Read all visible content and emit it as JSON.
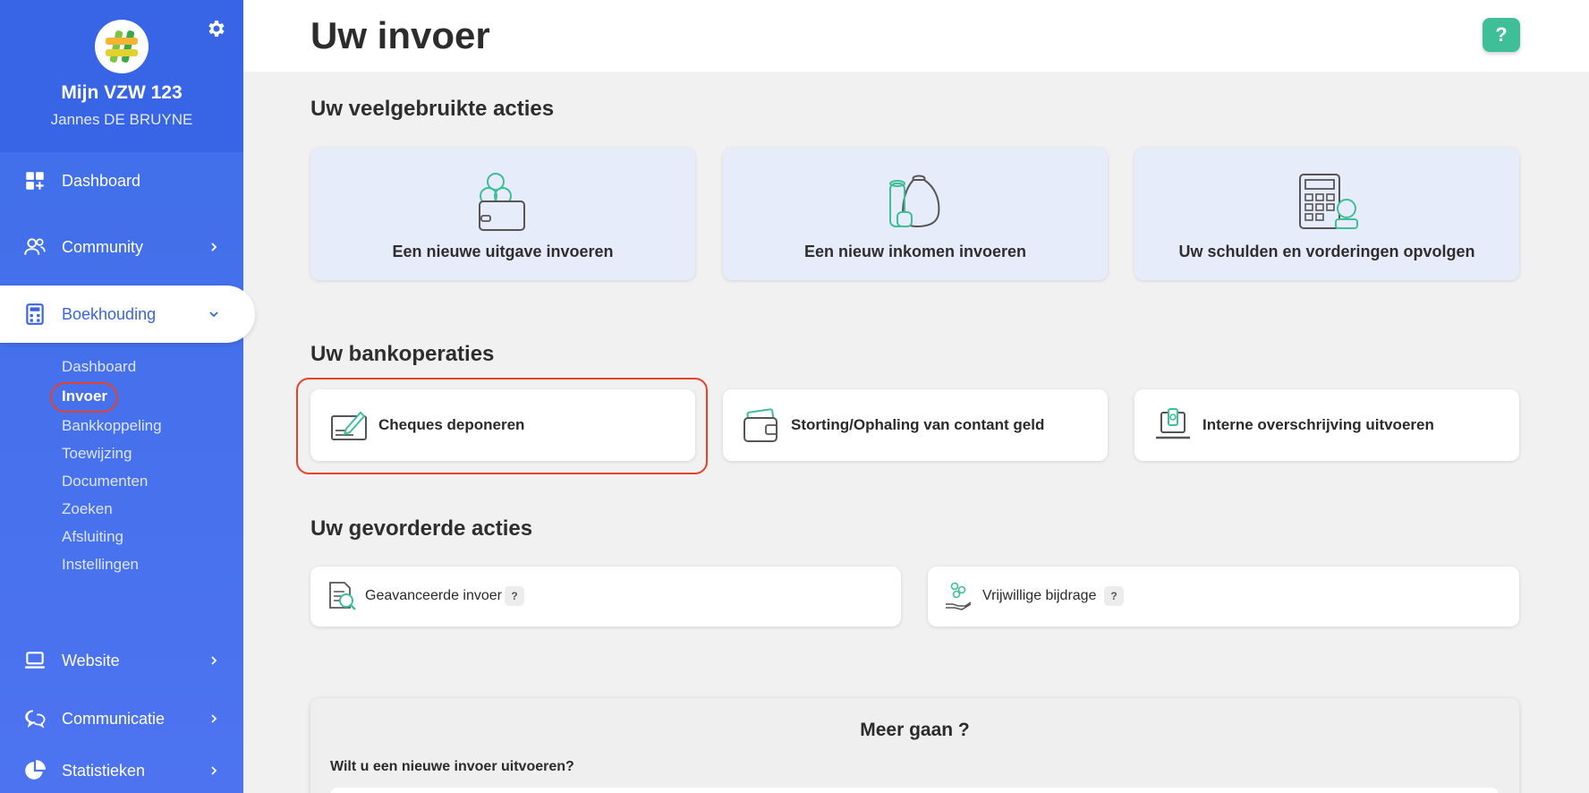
{
  "sidebar": {
    "org_name": "Mijn VZW 123",
    "user_name": "Jannes DE BRUYNE",
    "nav": {
      "dashboard": "Dashboard",
      "community": "Community",
      "boekhouding": "Boekhouding",
      "website": "Website",
      "communicatie": "Communicatie",
      "statistieken": "Statistieken"
    },
    "sub": [
      "Dashboard",
      "Invoer",
      "Bankkoppeling",
      "Toewijzing",
      "Documenten",
      "Zoeken",
      "Afsluiting",
      "Instellingen"
    ],
    "current_sub": "Invoer"
  },
  "header": {
    "title": "Uw invoer",
    "help": "?"
  },
  "sections": {
    "frequent": "Uw veelgebruikte acties",
    "bank": "Uw bankoperaties",
    "advanced": "Uw gevorderde acties"
  },
  "frequent_actions": [
    {
      "label": "Een nieuwe uitgave invoeren",
      "icon": "wallet-coins-icon"
    },
    {
      "label": "Een nieuw inkomen invoeren",
      "icon": "money-bag-icon"
    },
    {
      "label": "Uw schulden en vorderingen opvolgen",
      "icon": "calculator-coins-icon"
    }
  ],
  "bank_actions": [
    {
      "label": "Cheques deponeren",
      "icon": "cheque-icon"
    },
    {
      "label": "Storting/Ophaling van contant geld",
      "icon": "cash-wallet-icon"
    },
    {
      "label": "Interne overschrijving uitvoeren",
      "icon": "laptop-transfer-icon"
    }
  ],
  "advanced_actions": [
    {
      "label": "Geavanceerde invoer",
      "badge": "?",
      "icon": "document-search-icon"
    },
    {
      "label": "Vrijwillige bijdrage",
      "badge": "?",
      "icon": "hand-coins-icon"
    }
  ],
  "more": {
    "title": "Meer gaan ?",
    "question": "Wilt u een nieuwe invoer uitvoeren?"
  },
  "colors": {
    "sidebar": "#4270ee",
    "accent_green": "#3fbf97",
    "highlight_red": "#e8412b",
    "card_blue": "#e6ecfa"
  }
}
